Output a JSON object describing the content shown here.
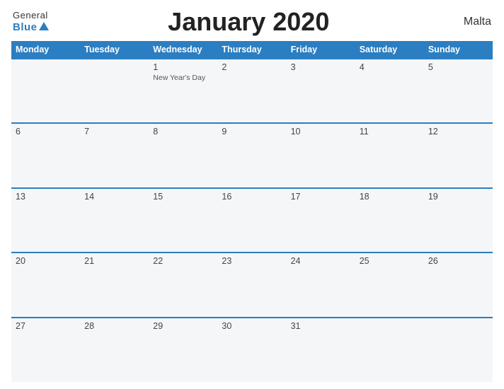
{
  "header": {
    "logo_general": "General",
    "logo_blue": "Blue",
    "title": "January 2020",
    "country": "Malta"
  },
  "days_of_week": [
    "Monday",
    "Tuesday",
    "Wednesday",
    "Thursday",
    "Friday",
    "Saturday",
    "Sunday"
  ],
  "weeks": [
    [
      {
        "day": "",
        "empty": true
      },
      {
        "day": "",
        "empty": true
      },
      {
        "day": "1",
        "holiday": "New Year's Day"
      },
      {
        "day": "2"
      },
      {
        "day": "3"
      },
      {
        "day": "4"
      },
      {
        "day": "5"
      }
    ],
    [
      {
        "day": "6"
      },
      {
        "day": "7"
      },
      {
        "day": "8"
      },
      {
        "day": "9"
      },
      {
        "day": "10"
      },
      {
        "day": "11"
      },
      {
        "day": "12"
      }
    ],
    [
      {
        "day": "13"
      },
      {
        "day": "14"
      },
      {
        "day": "15"
      },
      {
        "day": "16"
      },
      {
        "day": "17"
      },
      {
        "day": "18"
      },
      {
        "day": "19"
      }
    ],
    [
      {
        "day": "20"
      },
      {
        "day": "21"
      },
      {
        "day": "22"
      },
      {
        "day": "23"
      },
      {
        "day": "24"
      },
      {
        "day": "25"
      },
      {
        "day": "26"
      }
    ],
    [
      {
        "day": "27"
      },
      {
        "day": "28"
      },
      {
        "day": "29"
      },
      {
        "day": "30"
      },
      {
        "day": "31"
      },
      {
        "day": "",
        "empty": true
      },
      {
        "day": "",
        "empty": true
      }
    ]
  ]
}
